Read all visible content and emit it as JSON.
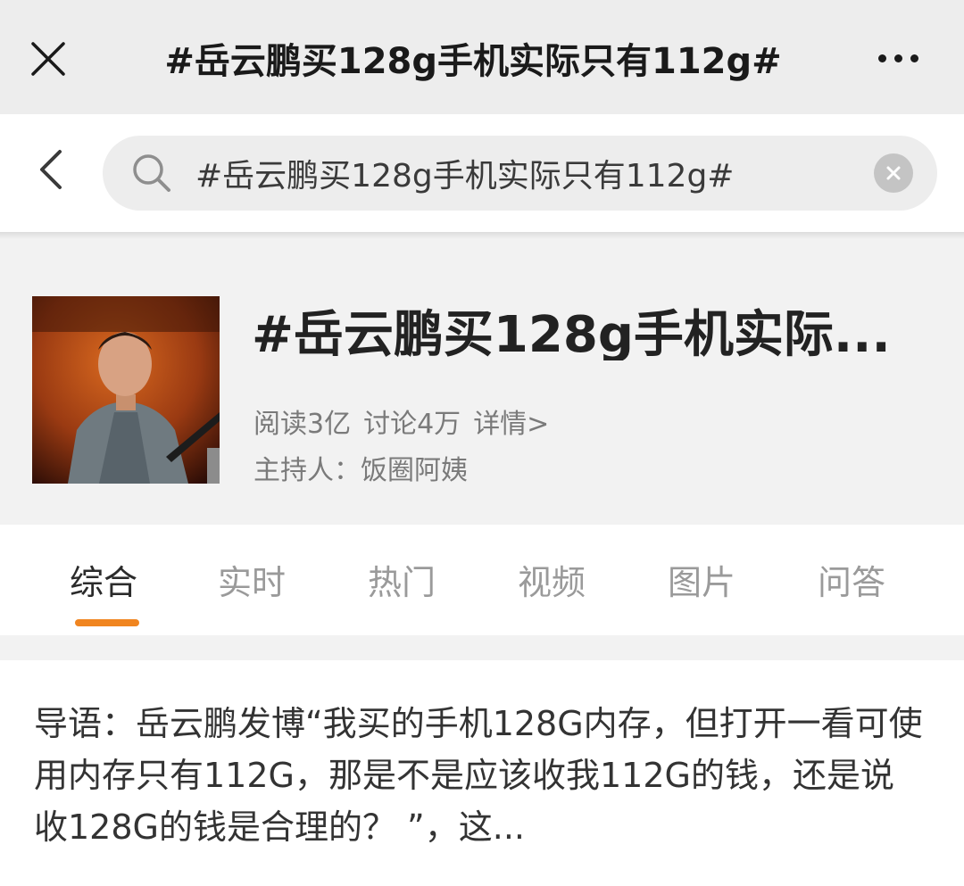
{
  "topbar": {
    "title": "#岳云鹏买128g手机实际只有112g#",
    "close_icon": "close-icon",
    "more_icon": "more-dots-icon"
  },
  "search": {
    "value": "#岳云鹏买128g手机实际只有112g#",
    "back_icon": "chevron-left-icon",
    "search_icon": "search-icon",
    "clear_icon": "clear-circle-icon"
  },
  "topic": {
    "title": "#岳云鹏买128g手机实际...",
    "reads": "阅读3亿",
    "discussions": "讨论4万",
    "details": "详情>",
    "host": "主持人：饭圈阿姨"
  },
  "tabs": [
    {
      "label": "综合",
      "active": true
    },
    {
      "label": "实时",
      "active": false
    },
    {
      "label": "热门",
      "active": false
    },
    {
      "label": "视频",
      "active": false
    },
    {
      "label": "图片",
      "active": false
    },
    {
      "label": "问答",
      "active": false
    }
  ],
  "intro": {
    "text": "导语：岳云鹏发博“我买的手机128G内存，但打开一看可使用内存只有112G，那是不是应该收我112G的钱，还是说收128G的钱是合理的？ ”，这..."
  },
  "colors": {
    "accent": "#f08520",
    "topbar_bg": "#ededed",
    "header_bg": "#f2f2f2"
  }
}
